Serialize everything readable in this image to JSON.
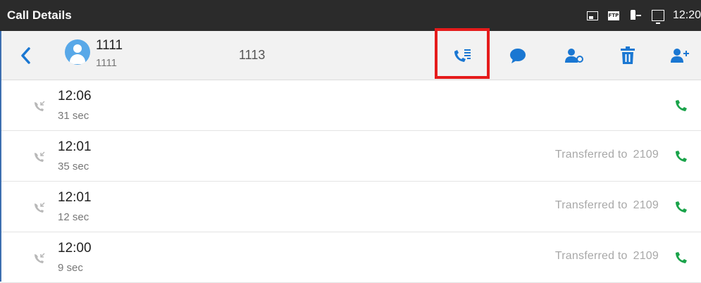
{
  "status_bar": {
    "title": "Call Details",
    "time": "12:20",
    "icons": [
      "image-icon",
      "ftp-icon",
      "usb-icon",
      "monitor-icon"
    ]
  },
  "header": {
    "contact_name": "1111",
    "contact_number": "1111",
    "local_number": "1113",
    "actions": [
      "call-log-icon",
      "message-icon",
      "contact-settings-icon",
      "delete-icon",
      "add-contact-icon"
    ]
  },
  "calls": [
    {
      "time": "12:06",
      "duration": "31 sec",
      "note_text": "",
      "note_number": ""
    },
    {
      "time": "12:01",
      "duration": "35 sec",
      "note_text": "Transferred to",
      "note_number": "2109"
    },
    {
      "time": "12:01",
      "duration": "12 sec",
      "note_text": "Transferred to",
      "note_number": "2109"
    },
    {
      "time": "12:00",
      "duration": "9 sec",
      "note_text": "Transferred to",
      "note_number": "2109"
    }
  ],
  "colors": {
    "accent": "#1a77d2",
    "call_green": "#1aa34a",
    "status_bar": "#2b2b2b",
    "highlight": "#e51b1b",
    "avatar": "#58a8e8"
  }
}
